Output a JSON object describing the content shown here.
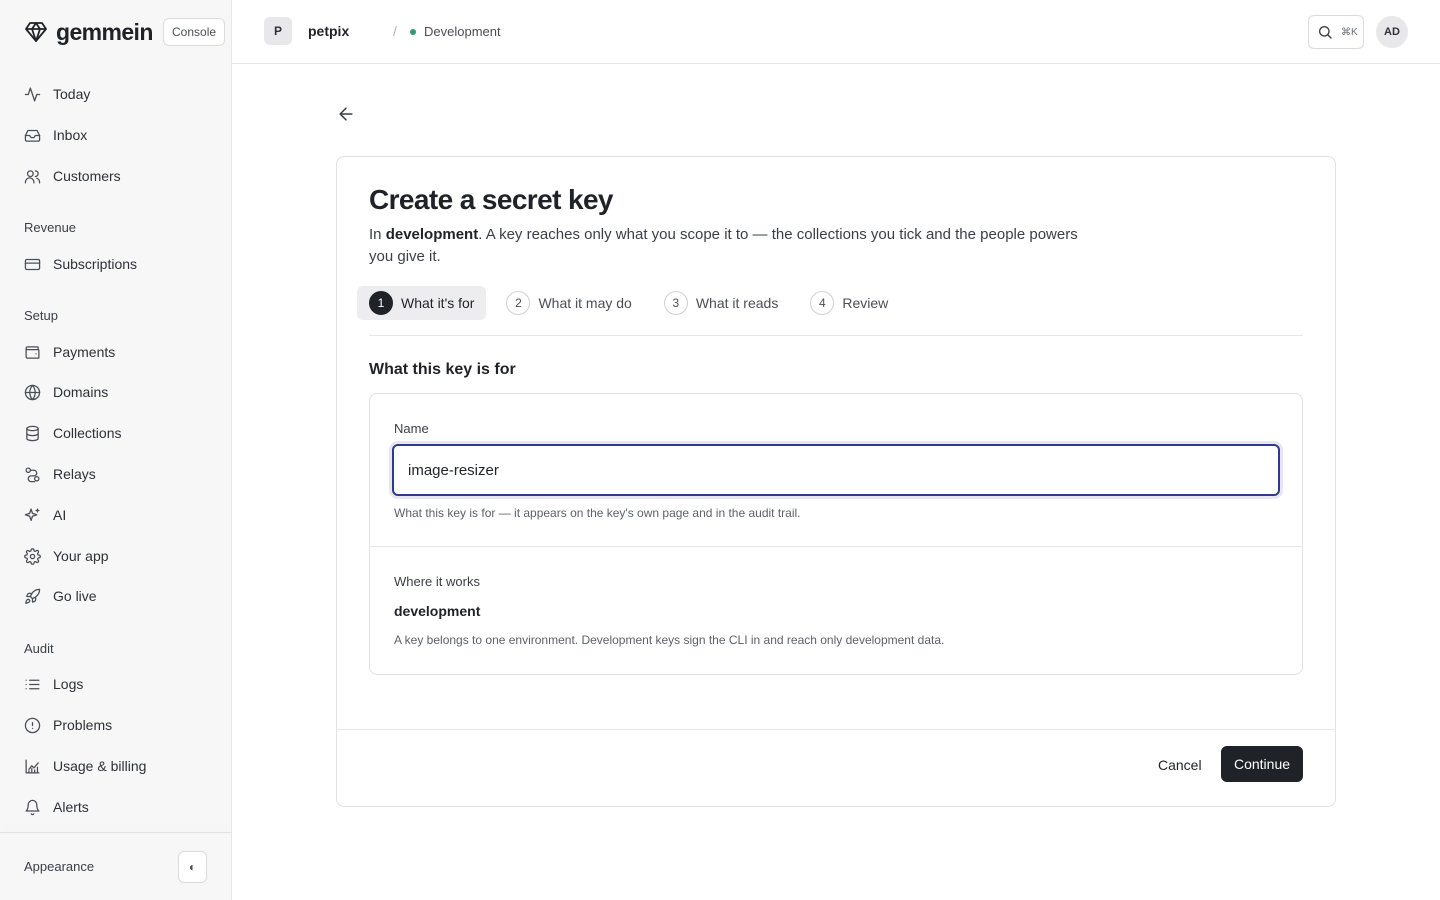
{
  "brand": {
    "name": "gemmein",
    "badge": "Console",
    "logo_icon": "gem-icon"
  },
  "sidebar": {
    "items_top": [
      {
        "label": "Today",
        "icon": "activity-icon"
      },
      {
        "label": "Inbox",
        "icon": "inbox-icon"
      },
      {
        "label": "Customers",
        "icon": "users-icon"
      }
    ],
    "sections": [
      {
        "title": "Revenue",
        "items": [
          {
            "label": "Subscriptions",
            "icon": "credit-card-icon"
          }
        ]
      },
      {
        "title": "Setup",
        "items": [
          {
            "label": "Payments",
            "icon": "wallet-icon"
          },
          {
            "label": "Domains",
            "icon": "globe-icon"
          },
          {
            "label": "Collections",
            "icon": "database-icon"
          },
          {
            "label": "Relays",
            "icon": "route-icon"
          },
          {
            "label": "AI",
            "icon": "sparkles-icon"
          },
          {
            "label": "Your app",
            "icon": "gear-icon"
          },
          {
            "label": "Go live",
            "icon": "rocket-icon"
          }
        ]
      },
      {
        "title": "Audit",
        "items": [
          {
            "label": "Logs",
            "icon": "list-icon"
          },
          {
            "label": "Problems",
            "icon": "alert-circle-icon"
          },
          {
            "label": "Usage & billing",
            "icon": "chart-icon"
          },
          {
            "label": "Alerts",
            "icon": "bell-icon"
          }
        ]
      }
    ],
    "appearance_label": "Appearance",
    "appearance_toggle": "◐"
  },
  "topbar": {
    "project_initial": "P",
    "project_name": "petpix",
    "separator": "/",
    "environment": "Development",
    "search_shortcut": "⌘K",
    "user_initials": "AD"
  },
  "page": {
    "title": "Create a secret key",
    "desc_prefix": "In ",
    "desc_env": "development",
    "desc_rest": ". A key reaches only what you scope it to — the collections you tick and the people powers you give it.",
    "steps": [
      {
        "num": "1",
        "label": "What it's for",
        "active": true
      },
      {
        "num": "2",
        "label": "What it may do",
        "active": false
      },
      {
        "num": "3",
        "label": "What it reads",
        "active": false
      },
      {
        "num": "4",
        "label": "Review",
        "active": false
      }
    ],
    "section_title": "What this key is for",
    "name_label": "Name",
    "name_value": "image-resizer",
    "name_help": "What this key is for — it appears on the key's own page and in the audit trail.",
    "where_label": "Where it works",
    "where_value": "development",
    "where_help": "A key belongs to one environment. Development keys sign the CLI in and reach only development data.",
    "cancel_label": "Cancel",
    "continue_label": "Continue"
  },
  "colors": {
    "accent": "#2f3a8f",
    "primary_button": "#1f2328",
    "env_dot": "#2f9e6e"
  }
}
